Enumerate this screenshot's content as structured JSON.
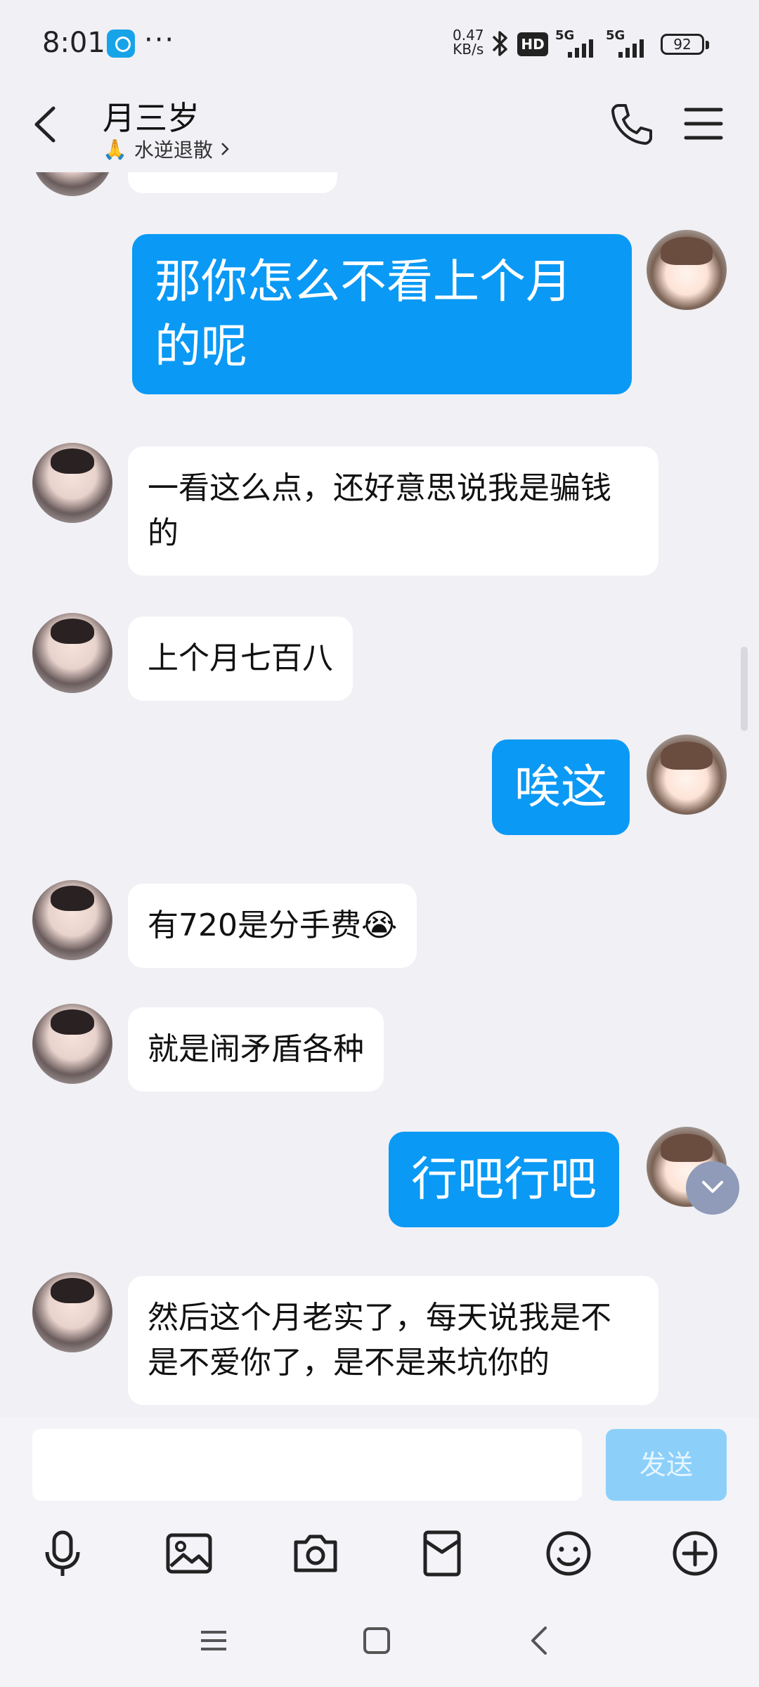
{
  "status_bar": {
    "time": "8:01",
    "more": "···",
    "net_speed_value": "0.47",
    "net_speed_unit": "KB/s",
    "hd_badge": "HD",
    "signal1": "5G",
    "signal2": "5G",
    "battery": "92"
  },
  "header": {
    "contact_name": "月三岁",
    "contact_status": "水逆退散",
    "status_emoji": "🙏"
  },
  "messages": [
    {
      "side": "out",
      "text": "那你怎么不看上个月的呢"
    },
    {
      "side": "in",
      "text": "一看这么点，还好意思说我是骗钱的"
    },
    {
      "side": "in",
      "text": "上个月七百八"
    },
    {
      "side": "out",
      "text": "唉这"
    },
    {
      "side": "in",
      "text": "有720是分手费",
      "emoji": "😭"
    },
    {
      "side": "in",
      "text": "就是闹矛盾各种"
    },
    {
      "side": "out",
      "text": "行吧行吧"
    },
    {
      "side": "in",
      "text": "然后这个月老实了，每天说我是不是不爱你了，是不是来坑你的"
    }
  ],
  "composer": {
    "input_value": "",
    "send_label": "发送"
  },
  "colors": {
    "outgoing_bubble": "#0a99f5",
    "incoming_bubble": "#ffffff",
    "background": "#f0f0f5",
    "send_button": "#8cd0fa"
  }
}
